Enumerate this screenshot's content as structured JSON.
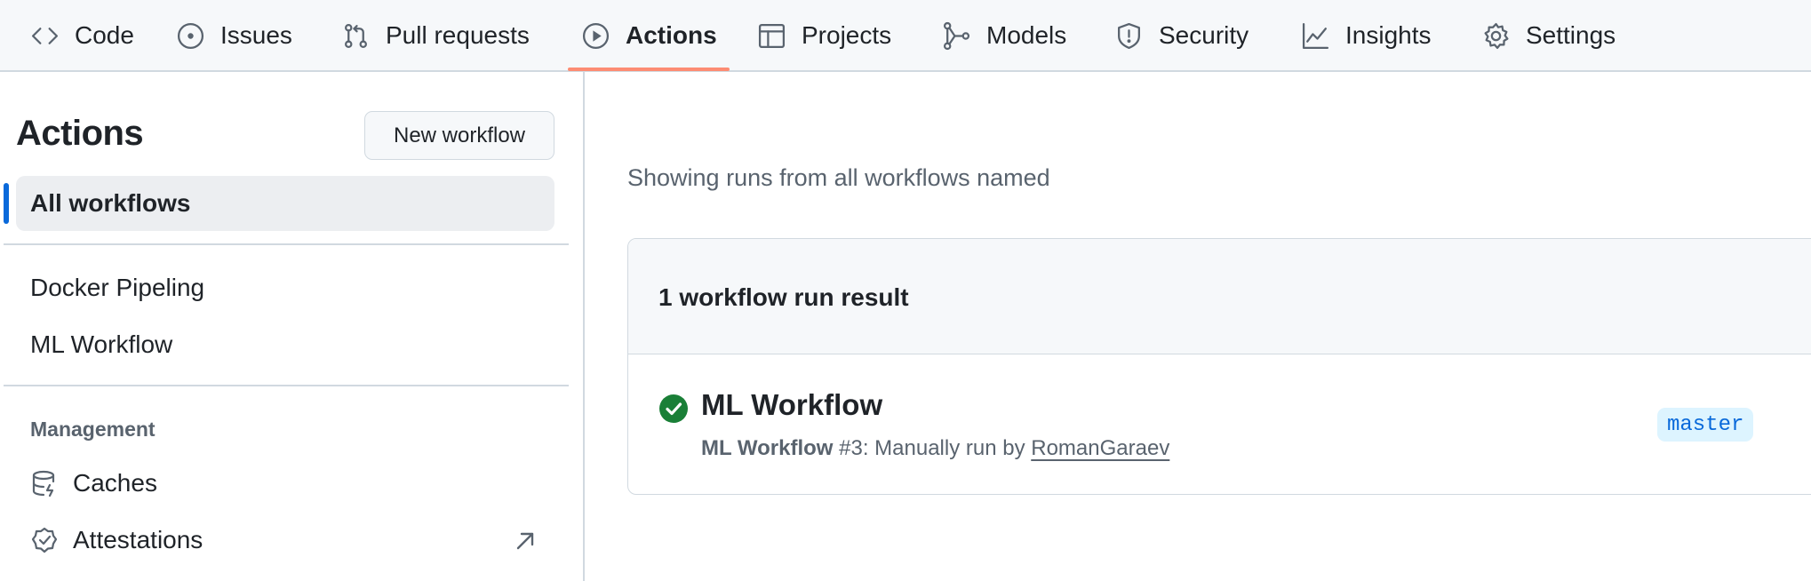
{
  "nav": {
    "tabs": [
      {
        "label": "Code",
        "icon": "code-icon"
      },
      {
        "label": "Issues",
        "icon": "issue-opened-icon"
      },
      {
        "label": "Pull requests",
        "icon": "git-pull-request-icon"
      },
      {
        "label": "Actions",
        "icon": "play-icon",
        "active": true
      },
      {
        "label": "Projects",
        "icon": "table-icon"
      },
      {
        "label": "Models",
        "icon": "models-icon"
      },
      {
        "label": "Security",
        "icon": "shield-icon"
      },
      {
        "label": "Insights",
        "icon": "graph-icon"
      },
      {
        "label": "Settings",
        "icon": "gear-icon"
      }
    ],
    "active_underline_color": "#fd8c73"
  },
  "sidebar": {
    "title": "Actions",
    "new_workflow_label": "New workflow",
    "all_workflows_label": "All workflows",
    "workflows": [
      "Docker Pipeling",
      "ML Workflow"
    ],
    "management_heading": "Management",
    "management_items": [
      {
        "label": "Caches",
        "icon": "database-icon"
      },
      {
        "label": "Attestations",
        "icon": "verified-icon",
        "trailing_icon": "arrow-up-right-icon"
      }
    ]
  },
  "main": {
    "showing_text": "Showing runs from all workflows named",
    "results_heading": "1 workflow run result",
    "run": {
      "status": "success",
      "status_color": "#1a7f37",
      "title": "ML Workflow",
      "workflow_name": "ML Workflow",
      "run_number_text": "#3: Manually run by",
      "user": "RomanGaraev",
      "branch": "master"
    }
  }
}
